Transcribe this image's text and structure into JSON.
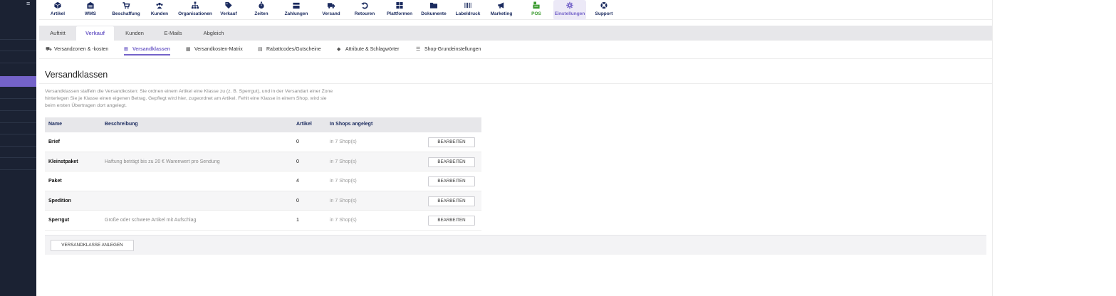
{
  "topnav": {
    "items": [
      {
        "label": "Artikel",
        "icon": "cube-icon"
      },
      {
        "label": "WMS",
        "icon": "warehouse-icon"
      },
      {
        "label": "Beschaffung",
        "icon": "cart-icon"
      },
      {
        "label": "Kunden",
        "icon": "users-icon"
      },
      {
        "label": "Organisationen",
        "icon": "org-chart-icon"
      },
      {
        "label": "Verkauf",
        "icon": "tag-icon"
      },
      {
        "label": "Zeiten",
        "icon": "stopwatch-icon"
      },
      {
        "label": "Zahlungen",
        "icon": "cash-register-icon"
      },
      {
        "label": "Versand",
        "icon": "truck-icon"
      },
      {
        "label": "Retouren",
        "icon": "undo-icon"
      },
      {
        "label": "Plattformen",
        "icon": "grid-icon"
      },
      {
        "label": "Dokumente",
        "icon": "folder-icon"
      },
      {
        "label": "Labeldruck",
        "icon": "barcode-icon"
      },
      {
        "label": "Marketing",
        "icon": "megaphone-icon"
      },
      {
        "label": "POS",
        "icon": "pos-icon"
      },
      {
        "label": "Einstellungen",
        "icon": "gear-icon"
      },
      {
        "label": "Support",
        "icon": "lifebuoy-icon"
      }
    ],
    "active_label": "Einstellungen"
  },
  "tabs": [
    "Auftritt",
    "Verkauf",
    "Kunden",
    "E-Mails",
    "Abgleich"
  ],
  "subtabs": [
    {
      "label": "Versandzonen & -kosten",
      "icon": "truck-icon"
    },
    {
      "label": "Versandklassen",
      "icon": "sitemap-icon"
    },
    {
      "label": "Versandkosten-Matrix",
      "icon": "table-icon"
    },
    {
      "label": "Rabattcodes/Gutscheine",
      "icon": "ticket-icon"
    },
    {
      "label": "Attribute & Schlagwörter",
      "icon": "tag-icon"
    },
    {
      "label": "Shop-Grundeinstellungen",
      "icon": "list-icon"
    }
  ],
  "page": {
    "title": "Versandklassen",
    "description_lines": [
      "Versandklassen staffeln die Versandkosten: Sie ordnen einem Artikel eine Klasse zu (z. B. Sperrgut), und in der Versandart einer Zone",
      "hinterlegen Sie je Klasse einen eigenen Betrag. Gepflegt wird hier, zugeordnet am Artikel. Fehlt eine Klasse in einem Shop, wird sie",
      "beim ersten Übertragen dort angelegt."
    ]
  },
  "table": {
    "headers": [
      "Name",
      "Beschreibung",
      "Artikel",
      "In Shops angelegt"
    ],
    "rows": [
      {
        "name": "Brief",
        "description": "",
        "articles": "0",
        "shops": "in 7 Shop(s)"
      },
      {
        "name": "Kleinstpaket",
        "description": "Haftung beträgt bis zu 20 € Warenwert pro Sendung",
        "articles": "0",
        "shops": "in 7 Shop(s)"
      },
      {
        "name": "Paket",
        "description": "",
        "articles": "4",
        "shops": "in 7 Shop(s)"
      },
      {
        "name": "Spedition",
        "description": "",
        "articles": "0",
        "shops": "in 7 Shop(s)"
      },
      {
        "name": "Sperrgut",
        "description": "Große oder schwere Artikel mit Aufschlag",
        "articles": "1",
        "shops": "in 7 Shop(s)"
      }
    ],
    "edit_label": "BEARBEITEN"
  },
  "footer": {
    "add_label": "VERSANDKLASSE ANLEGEN"
  },
  "colors": {
    "accent": "#7463c9",
    "navy": "#1a2a5e",
    "sidebar": "#1b2233",
    "pos_green": "#3a9a2e"
  }
}
